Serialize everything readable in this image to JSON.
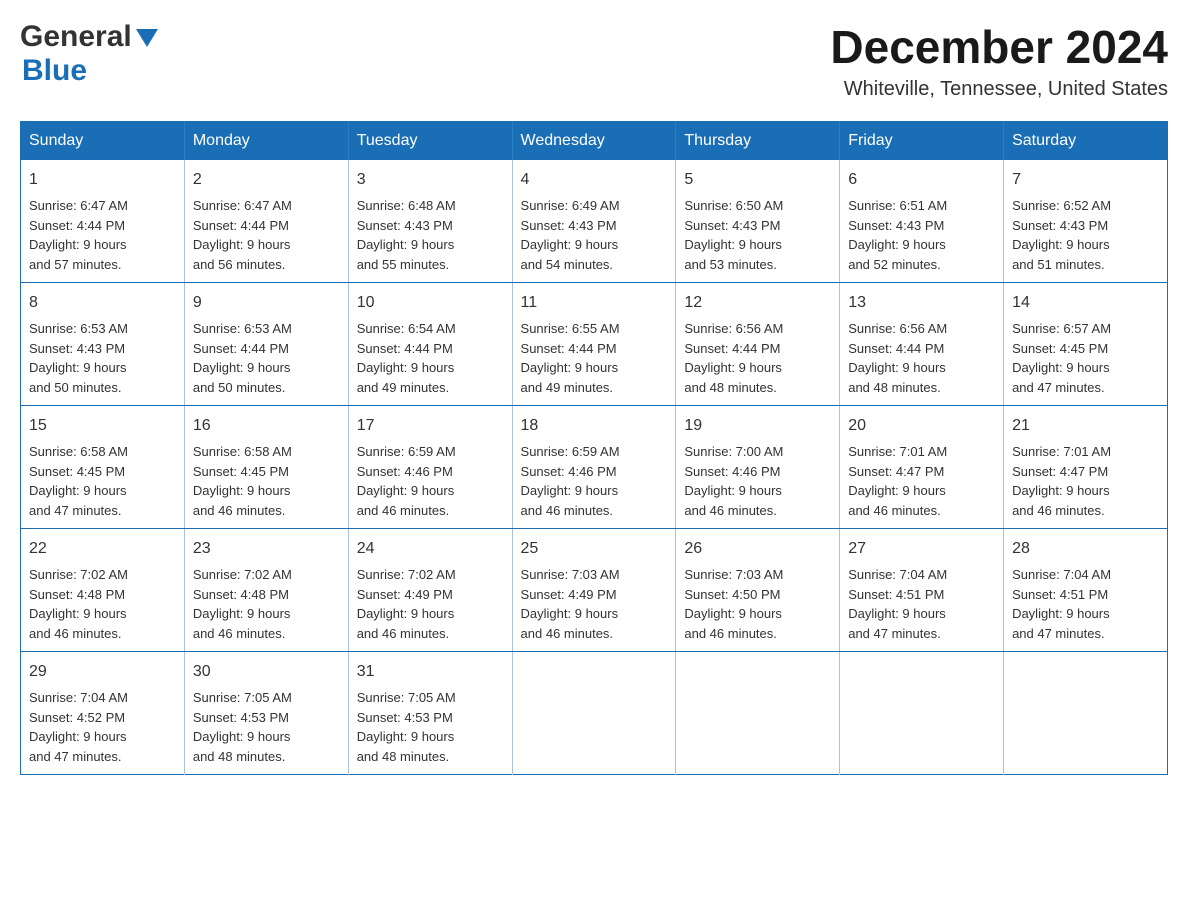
{
  "header": {
    "logo_general": "General",
    "logo_blue": "Blue",
    "month_title": "December 2024",
    "location": "Whiteville, Tennessee, United States"
  },
  "weekdays": [
    "Sunday",
    "Monday",
    "Tuesday",
    "Wednesday",
    "Thursday",
    "Friday",
    "Saturday"
  ],
  "weeks": [
    [
      {
        "day": "1",
        "sunrise": "6:47 AM",
        "sunset": "4:44 PM",
        "daylight": "9 hours and 57 minutes."
      },
      {
        "day": "2",
        "sunrise": "6:47 AM",
        "sunset": "4:44 PM",
        "daylight": "9 hours and 56 minutes."
      },
      {
        "day": "3",
        "sunrise": "6:48 AM",
        "sunset": "4:43 PM",
        "daylight": "9 hours and 55 minutes."
      },
      {
        "day": "4",
        "sunrise": "6:49 AM",
        "sunset": "4:43 PM",
        "daylight": "9 hours and 54 minutes."
      },
      {
        "day": "5",
        "sunrise": "6:50 AM",
        "sunset": "4:43 PM",
        "daylight": "9 hours and 53 minutes."
      },
      {
        "day": "6",
        "sunrise": "6:51 AM",
        "sunset": "4:43 PM",
        "daylight": "9 hours and 52 minutes."
      },
      {
        "day": "7",
        "sunrise": "6:52 AM",
        "sunset": "4:43 PM",
        "daylight": "9 hours and 51 minutes."
      }
    ],
    [
      {
        "day": "8",
        "sunrise": "6:53 AM",
        "sunset": "4:43 PM",
        "daylight": "9 hours and 50 minutes."
      },
      {
        "day": "9",
        "sunrise": "6:53 AM",
        "sunset": "4:44 PM",
        "daylight": "9 hours and 50 minutes."
      },
      {
        "day": "10",
        "sunrise": "6:54 AM",
        "sunset": "4:44 PM",
        "daylight": "9 hours and 49 minutes."
      },
      {
        "day": "11",
        "sunrise": "6:55 AM",
        "sunset": "4:44 PM",
        "daylight": "9 hours and 49 minutes."
      },
      {
        "day": "12",
        "sunrise": "6:56 AM",
        "sunset": "4:44 PM",
        "daylight": "9 hours and 48 minutes."
      },
      {
        "day": "13",
        "sunrise": "6:56 AM",
        "sunset": "4:44 PM",
        "daylight": "9 hours and 48 minutes."
      },
      {
        "day": "14",
        "sunrise": "6:57 AM",
        "sunset": "4:45 PM",
        "daylight": "9 hours and 47 minutes."
      }
    ],
    [
      {
        "day": "15",
        "sunrise": "6:58 AM",
        "sunset": "4:45 PM",
        "daylight": "9 hours and 47 minutes."
      },
      {
        "day": "16",
        "sunrise": "6:58 AM",
        "sunset": "4:45 PM",
        "daylight": "9 hours and 46 minutes."
      },
      {
        "day": "17",
        "sunrise": "6:59 AM",
        "sunset": "4:46 PM",
        "daylight": "9 hours and 46 minutes."
      },
      {
        "day": "18",
        "sunrise": "6:59 AM",
        "sunset": "4:46 PM",
        "daylight": "9 hours and 46 minutes."
      },
      {
        "day": "19",
        "sunrise": "7:00 AM",
        "sunset": "4:46 PM",
        "daylight": "9 hours and 46 minutes."
      },
      {
        "day": "20",
        "sunrise": "7:01 AM",
        "sunset": "4:47 PM",
        "daylight": "9 hours and 46 minutes."
      },
      {
        "day": "21",
        "sunrise": "7:01 AM",
        "sunset": "4:47 PM",
        "daylight": "9 hours and 46 minutes."
      }
    ],
    [
      {
        "day": "22",
        "sunrise": "7:02 AM",
        "sunset": "4:48 PM",
        "daylight": "9 hours and 46 minutes."
      },
      {
        "day": "23",
        "sunrise": "7:02 AM",
        "sunset": "4:48 PM",
        "daylight": "9 hours and 46 minutes."
      },
      {
        "day": "24",
        "sunrise": "7:02 AM",
        "sunset": "4:49 PM",
        "daylight": "9 hours and 46 minutes."
      },
      {
        "day": "25",
        "sunrise": "7:03 AM",
        "sunset": "4:49 PM",
        "daylight": "9 hours and 46 minutes."
      },
      {
        "day": "26",
        "sunrise": "7:03 AM",
        "sunset": "4:50 PM",
        "daylight": "9 hours and 46 minutes."
      },
      {
        "day": "27",
        "sunrise": "7:04 AM",
        "sunset": "4:51 PM",
        "daylight": "9 hours and 47 minutes."
      },
      {
        "day": "28",
        "sunrise": "7:04 AM",
        "sunset": "4:51 PM",
        "daylight": "9 hours and 47 minutes."
      }
    ],
    [
      {
        "day": "29",
        "sunrise": "7:04 AM",
        "sunset": "4:52 PM",
        "daylight": "9 hours and 47 minutes."
      },
      {
        "day": "30",
        "sunrise": "7:05 AM",
        "sunset": "4:53 PM",
        "daylight": "9 hours and 48 minutes."
      },
      {
        "day": "31",
        "sunrise": "7:05 AM",
        "sunset": "4:53 PM",
        "daylight": "9 hours and 48 minutes."
      },
      null,
      null,
      null,
      null
    ]
  ],
  "labels": {
    "sunrise": "Sunrise: ",
    "sunset": "Sunset: ",
    "daylight": "Daylight: "
  }
}
